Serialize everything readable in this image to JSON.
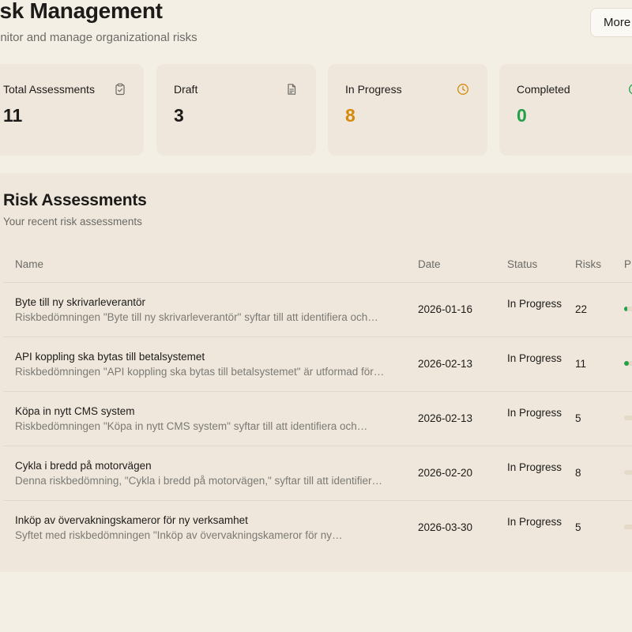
{
  "header": {
    "title": "isk Management",
    "subtitle": "onitor and manage organizational risks",
    "more_button": "More A"
  },
  "stats": [
    {
      "label": "Total Assessments",
      "value": "11",
      "icon": "clipboard-check-icon",
      "color": "#1c1b19"
    },
    {
      "label": "Draft",
      "value": "3",
      "icon": "document-icon",
      "color": "#1c1b19"
    },
    {
      "label": "In Progress",
      "value": "8",
      "icon": "clock-icon",
      "color": "#d4890a"
    },
    {
      "label": "Completed",
      "value": "0",
      "icon": "check-circle-icon",
      "color": "#22a04a"
    }
  ],
  "assessments": {
    "title": "Risk Assessments",
    "subtitle": "Your recent risk assessments",
    "columns": {
      "name": "Name",
      "date": "Date",
      "status": "Status",
      "risks": "Risks",
      "progress": "P"
    },
    "rows": [
      {
        "name": "Byte till ny skrivarleverantör",
        "description": "Riskbedömningen \"Byte till ny skrivarleverantör\" syftar till att identifiera och…",
        "date": "2026-01-16",
        "status": "In Progress",
        "risks": "22",
        "progress": 0.1
      },
      {
        "name": "API koppling ska bytas till betalsystemet",
        "description": "Riskbedömningen \"API koppling ska bytas till betalsystemet\" är utformad för…",
        "date": "2026-02-13",
        "status": "In Progress",
        "risks": "11",
        "progress": 0.15
      },
      {
        "name": "Köpa in nytt CMS system",
        "description": "Riskbedömningen \"Köpa in nytt CMS system\" syftar till att identifiera och…",
        "date": "2026-02-13",
        "status": "In Progress",
        "risks": "5",
        "progress": 0
      },
      {
        "name": "Cykla i bredd på motorvägen",
        "description": "Denna riskbedömning, \"Cykla i bredd på motorvägen,\" syftar till att identifier…",
        "date": "2026-02-20",
        "status": "In Progress",
        "risks": "8",
        "progress": 0
      },
      {
        "name": "Inköp av övervakningskameror för ny verksamhet",
        "description": "Syftet med riskbedömningen \"Inköp av övervakningskameror för ny…",
        "date": "2026-03-30",
        "status": "In Progress",
        "risks": "5",
        "progress": 0
      }
    ]
  }
}
